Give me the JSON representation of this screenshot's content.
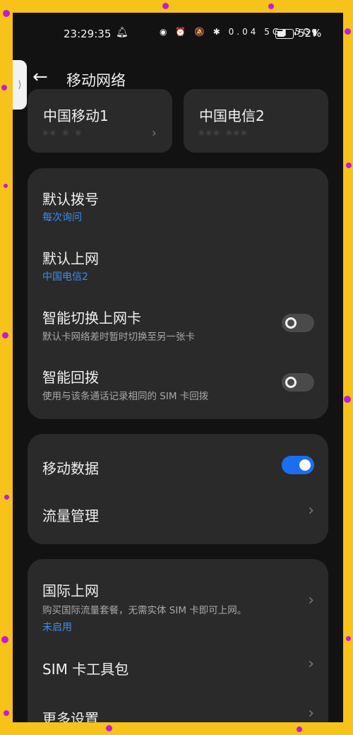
{
  "status_bar": {
    "time": "23:29:35",
    "bell_icon": "bell",
    "icons_text": "◉ ⏰ 🔕 ✱ 0.04 5G▮ 5G▮",
    "battery_text": "52%",
    "battery_level": 0.52
  },
  "header": {
    "title": "移动网络"
  },
  "sim_cards": [
    {
      "name": "中国移动1",
      "number": "•• • •"
    },
    {
      "name": "中国电信2",
      "number": "••• •••"
    }
  ],
  "group1": {
    "default_dial": {
      "title": "默认拨号",
      "value": "每次询问"
    },
    "default_data": {
      "title": "默认上网",
      "value": "中国电信2"
    },
    "smart_switch": {
      "title": "智能切换上网卡",
      "subtitle": "默认卡网络差时暂时切换至另一张卡",
      "enabled": false
    },
    "smart_callback": {
      "title": "智能回拨",
      "subtitle": "使用与该条通话记录相同的 SIM 卡回拨",
      "enabled": false
    }
  },
  "group2": {
    "mobile_data": {
      "title": "移动数据",
      "enabled": true
    },
    "traffic": {
      "title": "流量管理"
    }
  },
  "group3": {
    "intl": {
      "title": "国际上网",
      "subtitle": "购买国际流量套餐，无需实体 SIM 卡即可上网。",
      "status": "未启用"
    },
    "sim_toolkit": {
      "title": "SIM 卡工具包"
    },
    "more": {
      "title": "更多设置"
    }
  },
  "colors": {
    "background_frame": "#f7c21a",
    "accent_blue": "#1a6ff0",
    "link_blue": "#3d8cf0",
    "card": "#2a2a2a"
  }
}
